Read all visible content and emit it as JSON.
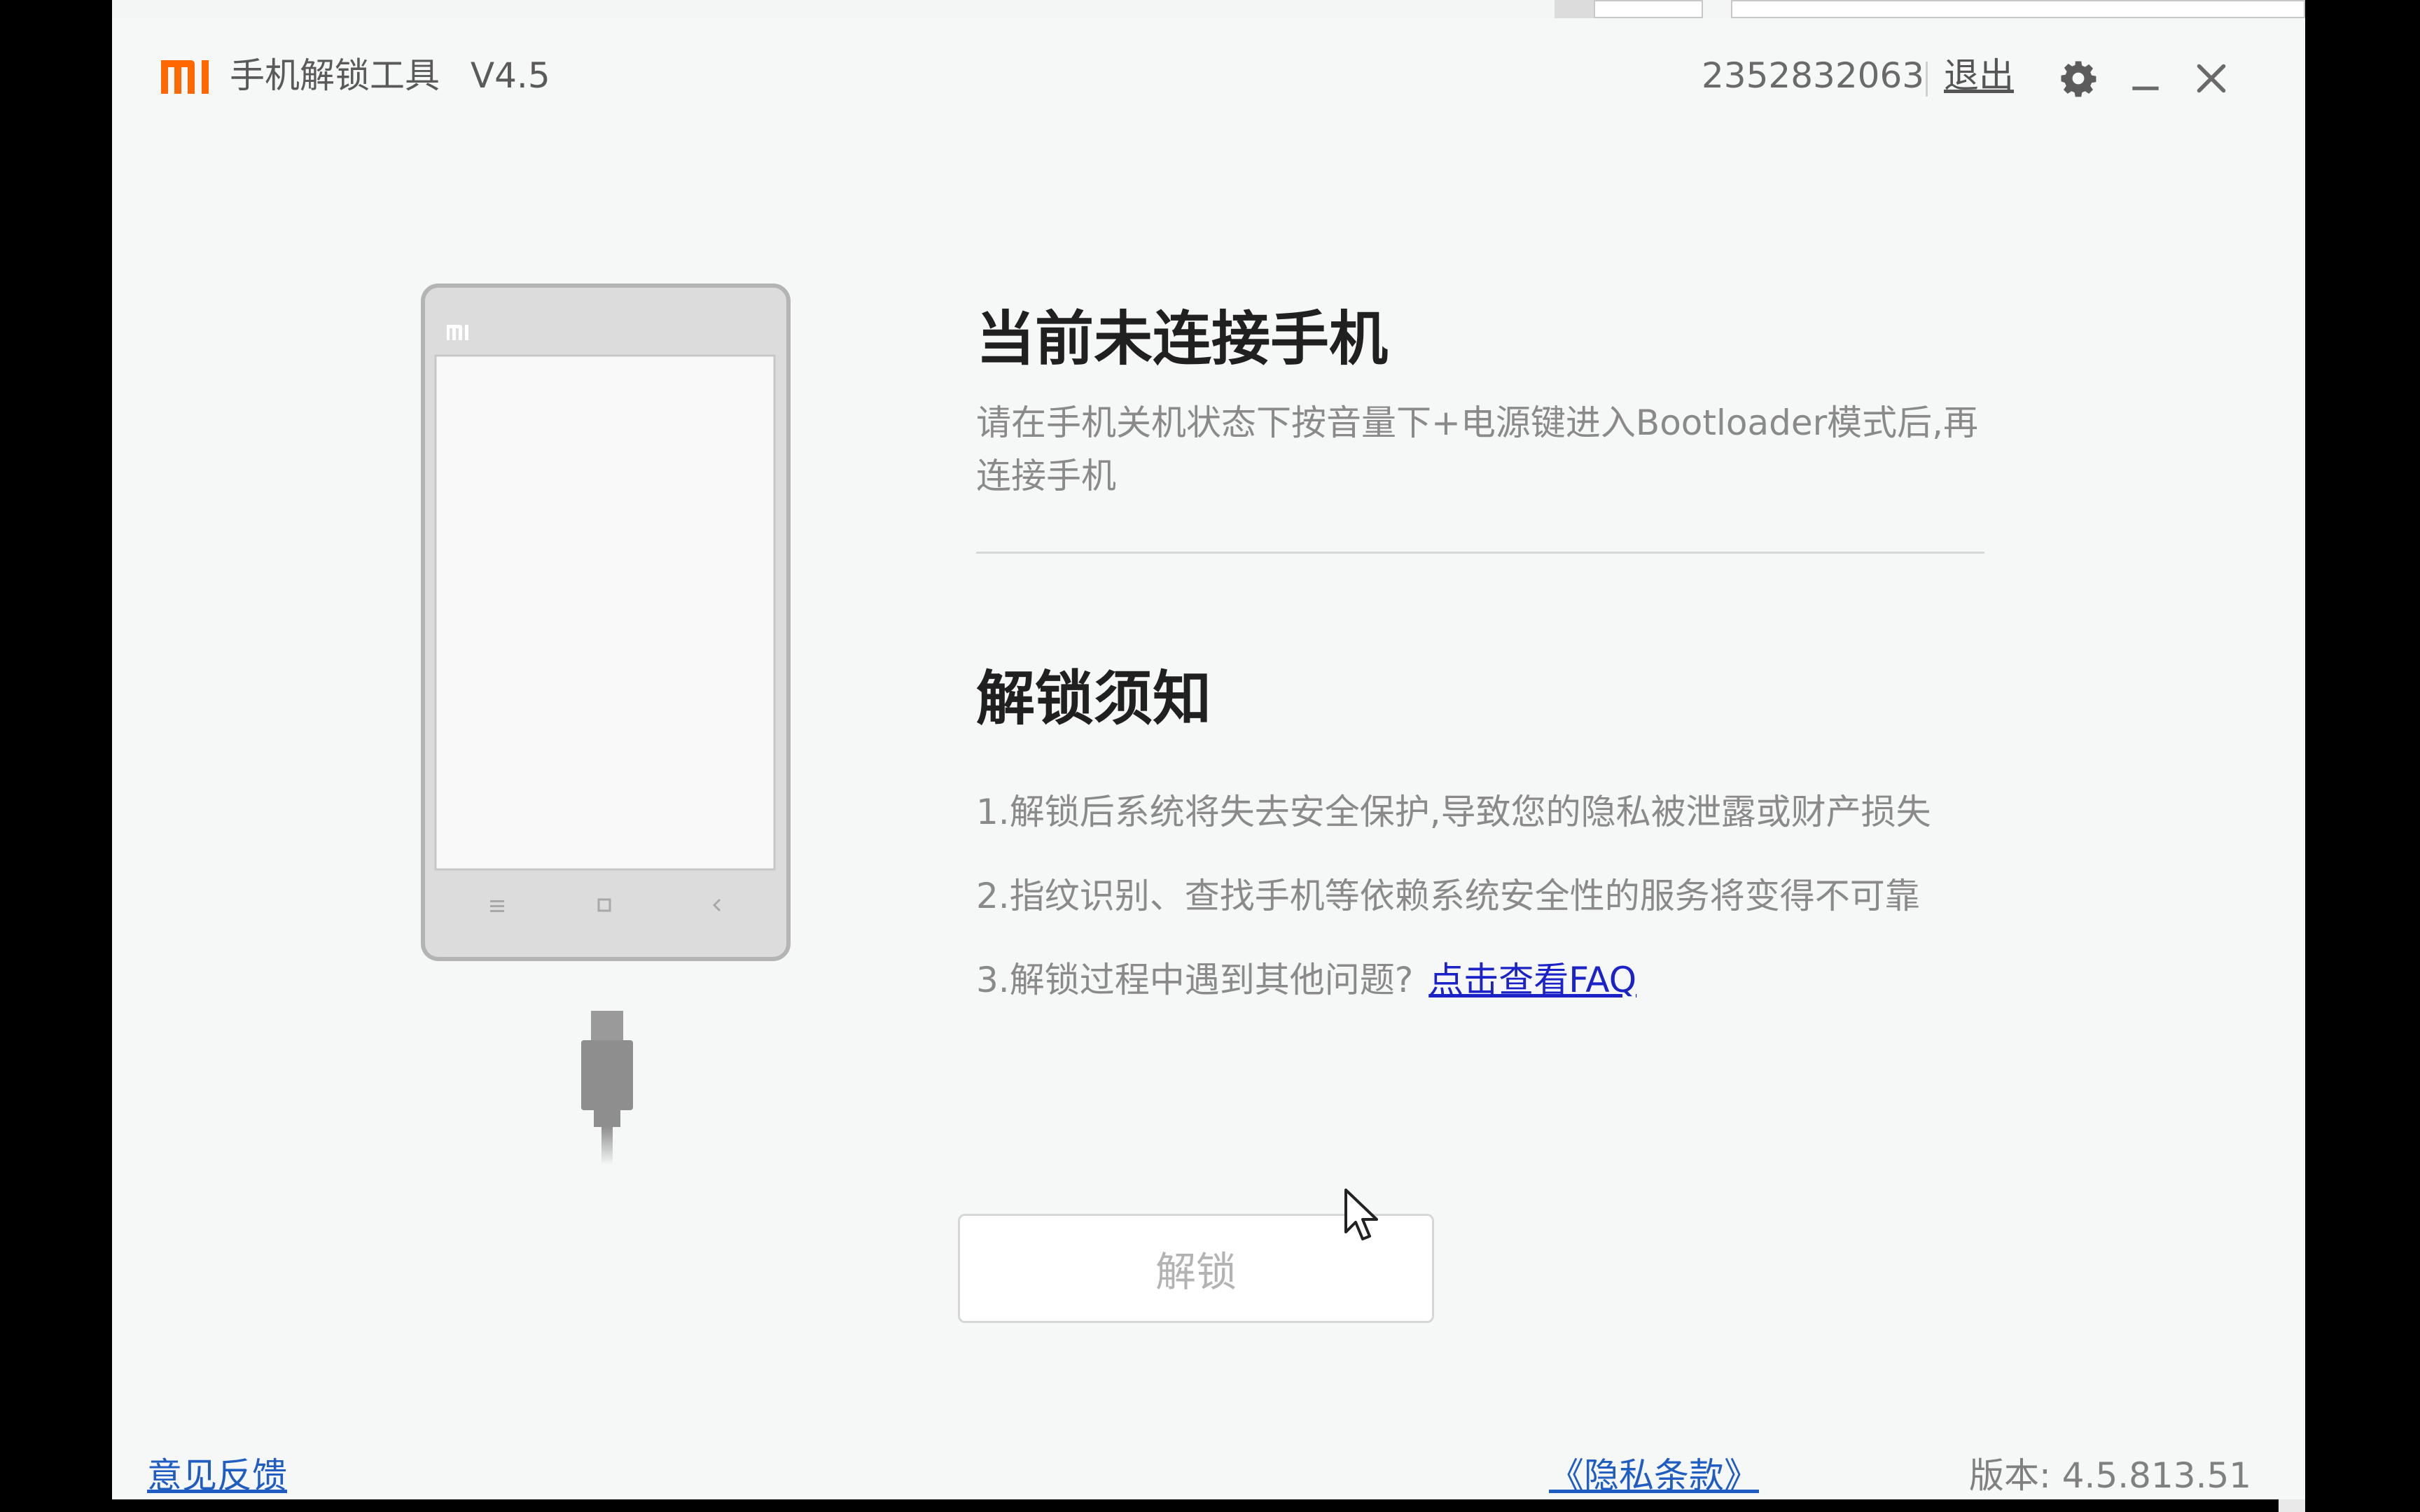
{
  "window": {
    "title": "手机解锁工具",
    "version_label": "V4.5"
  },
  "header": {
    "account_id": "2352832063",
    "logout_label": "退出",
    "settings_icon": "gear-icon",
    "minimize_icon": "minimize-icon",
    "close_icon": "close-icon"
  },
  "status": {
    "title": "当前未连接手机",
    "description": "请在手机关机状态下按音量下+电源键进入Bootloader模式后,再连接手机"
  },
  "notice": {
    "title": "解锁须知",
    "items": [
      "1.解锁后系统将失去安全保护,导致您的隐私被泄露或财产损失",
      "2.指纹识别、查找手机等依赖系统安全性的服务将变得不可靠",
      "3.解锁过程中遇到其他问题?"
    ],
    "faq_link": "点击查看FAQ"
  },
  "actions": {
    "unlock_label": "解锁"
  },
  "footer": {
    "feedback_label": "意见反馈",
    "privacy_label": "《隐私条款》",
    "version": "版本: 4.5.813.51"
  },
  "colors": {
    "brand": "#ff6700",
    "link": "#1a22c8",
    "footer_link": "#1f5dc2",
    "window_bg": "#f6f7f7"
  }
}
